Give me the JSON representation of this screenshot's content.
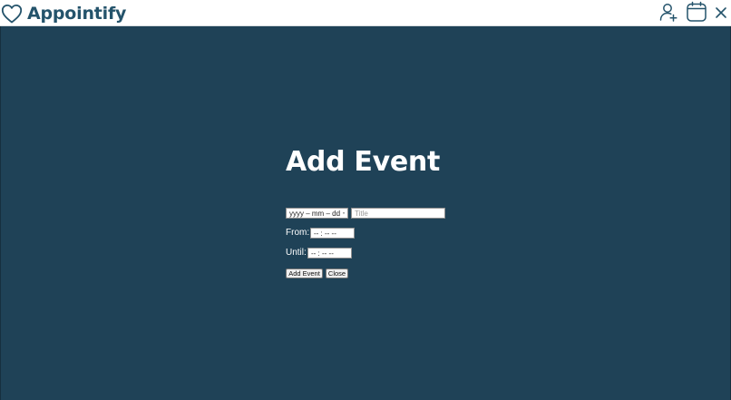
{
  "app": {
    "name": "Appointify",
    "logo_icon": "heart-icon",
    "header_icons": [
      "add-user-icon",
      "calendar-icon",
      "close-icon"
    ],
    "brand_color": "#24536b",
    "background_color": "#1f4257"
  },
  "form": {
    "title": "Add Event",
    "date_placeholder": "yyyy – mm – dd",
    "title_placeholder": "Title",
    "from_label": "From:",
    "from_placeholder": "-- : --   --",
    "until_label": "Until:",
    "until_placeholder": "-- : --   --",
    "add_button": "Add Event",
    "close_button": "Close"
  }
}
